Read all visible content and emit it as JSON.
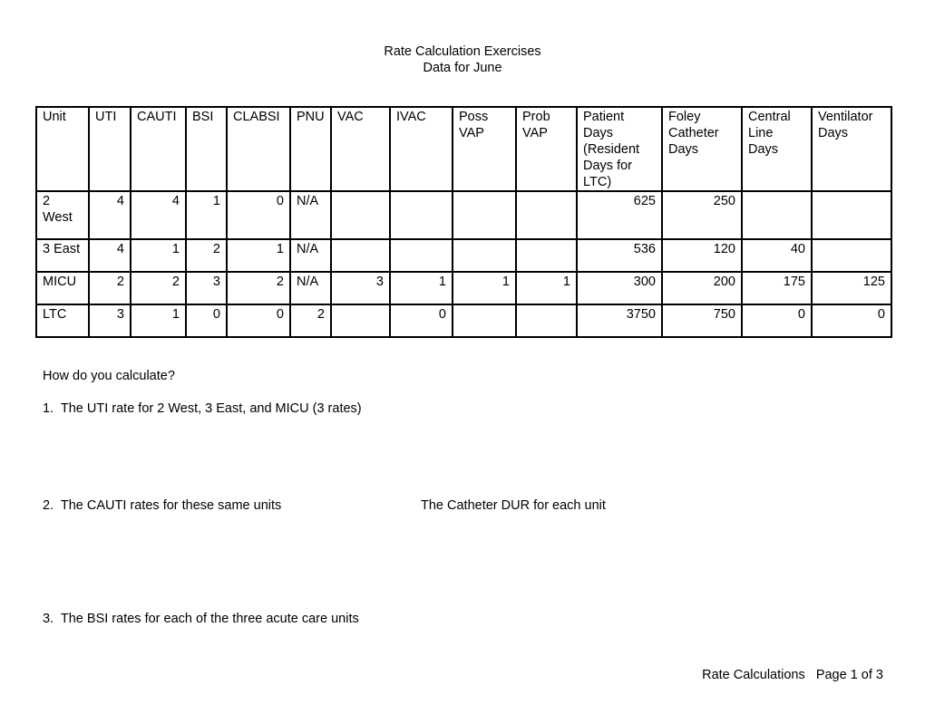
{
  "header": {
    "title": "Rate Calculation Exercises",
    "subtitle": "Data for June"
  },
  "table": {
    "columns": [
      "Unit",
      "UTI",
      "CAUTI",
      "BSI",
      "CLABSI",
      "PNU",
      "VAC",
      "IVAC",
      "Poss VAP",
      "Prob VAP",
      "Patient Days (Resident Days for LTC)",
      "Foley Catheter Days",
      "Central Line Days",
      "Ventilator Days"
    ],
    "rows": [
      {
        "unit": "2 West",
        "cells": [
          "4",
          "4",
          "1",
          "0",
          "N/A",
          "",
          "",
          "",
          "",
          "625",
          "250",
          "",
          ""
        ]
      },
      {
        "unit": "3 East",
        "cells": [
          "4",
          "1",
          "2",
          "1",
          "N/A",
          "",
          "",
          "",
          "",
          "536",
          "120",
          "40",
          ""
        ]
      },
      {
        "unit": "MICU",
        "cells": [
          "2",
          "2",
          "3",
          "2",
          "N/A",
          "3",
          "1",
          "1",
          "1",
          "300",
          "200",
          "175",
          "125"
        ]
      },
      {
        "unit": "LTC",
        "cells": [
          "3",
          "1",
          "0",
          "0",
          "2",
          "",
          "0",
          "",
          "",
          "3750",
          "750",
          "0",
          "0"
        ]
      }
    ]
  },
  "questions": {
    "intro": "How do you calculate?",
    "q1": "1.  The UTI rate for 2 West, 3 East, and MICU (3 rates)",
    "q2": "2.  The CAUTI rates for these same units",
    "q2b": "The Catheter DUR for each unit",
    "q3": "3.  The BSI rates for each of the three acute care units"
  },
  "footer": {
    "text": "Rate Calculations   Page 1 of 3"
  }
}
